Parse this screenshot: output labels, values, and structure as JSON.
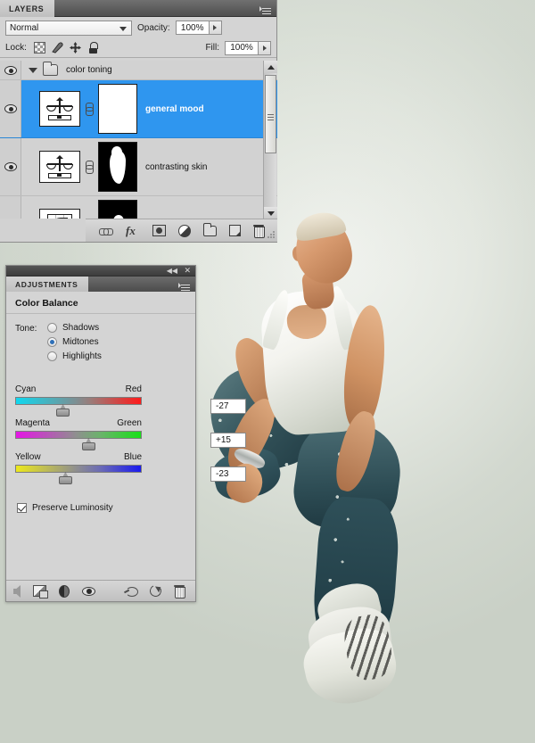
{
  "canvas": {
    "background_color": "#d9ddd6",
    "photo_alt": "man in white tank top and teal baggy jeans jumping"
  },
  "layers_panel": {
    "tab_label": "LAYERS",
    "menu_icon": "panel-menu-icon",
    "blend_mode": "Normal",
    "blend_caret_icon": "chevron-down-icon",
    "opacity_label": "Opacity:",
    "opacity_value": "100%",
    "opacity_stepper_icon": "stepper-arrow-icon",
    "lock_label": "Lock:",
    "lock_icons": [
      "lock-transparent-pixels-icon",
      "lock-image-pixels-icon",
      "lock-position-icon",
      "lock-all-icon"
    ],
    "fill_label": "Fill:",
    "fill_value": "100%",
    "fill_stepper_icon": "stepper-arrow-icon",
    "rows": [
      {
        "type": "group",
        "name": "color toning",
        "visible": true,
        "selected": false,
        "disclosure_icon": "triangle-down-icon",
        "icon": "folder-icon"
      },
      {
        "type": "adjustment",
        "name": "general mood",
        "visible": true,
        "selected": true,
        "thumb_icon": "color-balance-scales-icon",
        "link_icon": "link-mask-icon",
        "mask": "white"
      },
      {
        "type": "adjustment",
        "name": "contrasting skin",
        "visible": true,
        "selected": false,
        "thumb_icon": "color-balance-scales-icon",
        "link_icon": "link-mask-icon",
        "mask": "black"
      },
      {
        "type": "adjustment",
        "name": "",
        "visible": true,
        "selected": false,
        "thumb_icon": "curves-icon",
        "link_icon": "link-mask-icon",
        "mask": "black"
      }
    ],
    "scrollbar": {
      "up_arrow_icon": "scroll-up-arrow-icon",
      "down_arrow_icon": "scroll-down-arrow-icon",
      "thumb_icon": "scrollbar-thumb"
    },
    "footer_icons": [
      "link-layers-icon",
      "layer-styles-fx-icon",
      "add-layer-mask-icon",
      "new-adjustment-layer-icon",
      "new-group-icon",
      "new-layer-icon",
      "delete-layer-icon"
    ],
    "resize_grip_icon": "resize-grip-icon"
  },
  "adjustments_panel": {
    "collapse_icon": "collapse-to-icons-icon",
    "close_icon": "close-icon",
    "tab_label": "ADJUSTMENTS",
    "menu_icon": "panel-menu-icon",
    "title": "Color Balance",
    "tone_label": "Tone:",
    "tone_options": [
      {
        "label": "Shadows",
        "selected": false
      },
      {
        "label": "Midtones",
        "selected": true
      },
      {
        "label": "Highlights",
        "selected": false
      }
    ],
    "sliders": [
      {
        "left_label": "Cyan",
        "right_label": "Red",
        "value": "-27",
        "percent": 36.5,
        "name": "cyan-red-slider"
      },
      {
        "left_label": "Magenta",
        "right_label": "Green",
        "value": "+15",
        "percent": 57.0,
        "name": "magenta-green-slider"
      },
      {
        "left_label": "Yellow",
        "right_label": "Blue",
        "value": "-23",
        "percent": 38.5,
        "name": "yellow-blue-slider"
      }
    ],
    "preserve_luminosity": {
      "label": "Preserve Luminosity",
      "checked": true
    },
    "footer_icons": [
      "return-to-adjustment-list-icon",
      "clip-to-layer-icon",
      "toggle-layer-visibility-bw-icon",
      "preview-eye-icon",
      "view-previous-state-icon",
      "reset-adjustment-icon",
      "delete-adjustment-icon"
    ]
  }
}
